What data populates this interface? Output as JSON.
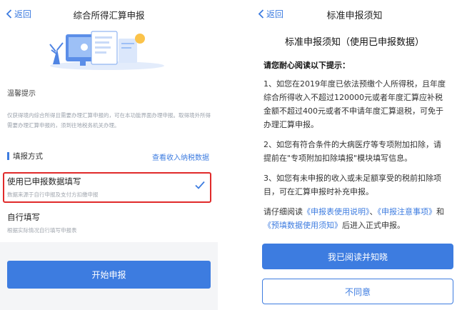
{
  "left": {
    "nav": {
      "back_label": "返回",
      "title": "综合所得汇算申报"
    },
    "notice": {
      "title": "温馨提示",
      "body": "仅获得境内综合所得且需要办理汇算申报的，可在本功能界面办理申报。取得境外所得需要办理汇算申报的，须到往地税务机关办理。"
    },
    "method": {
      "label": "填报方式",
      "link": "查看收入纳税数据",
      "options": [
        {
          "title": "使用已申报数据填写",
          "subtitle": "数据来源于自行申报及支付方扣缴申报",
          "selected": true
        },
        {
          "title": "自行填写",
          "subtitle": "根据实际情况自行填写申报表",
          "selected": false
        }
      ]
    },
    "start_button": "开始申报"
  },
  "right": {
    "nav": {
      "back_label": "返回",
      "title": "标准申报须知"
    },
    "doc_title": "标准申报须知（使用已申报数据）",
    "hint": "请您耐心阅读以下提示：",
    "paragraphs": [
      "1、如您在2019年度已依法预缴个人所得税，且年度综合所得收入不超过120000元或者年度汇算应补税金额不超过400元或者不申请年度汇算退税，可免于办理汇算申报。",
      "2、如您有符合条件的大病医疗等专项附加扣除，请提前在\"专项附加扣除填报\"模块填写信息。",
      "3、如您有未申报的收入或未足额享受的税前扣除项目，可在汇算申报时补充申报。"
    ],
    "final": {
      "prefix": "请仔细阅读",
      "link1": "《申报表使用说明》",
      "sep1": "、",
      "link2": "《申报注意事项》",
      "sep2": "和",
      "link3": "《预填数据使用须知》",
      "suffix": "后进入正式申报。"
    },
    "accept_button": "我已阅读并知晓",
    "reject_button": "不同意"
  },
  "colors": {
    "accent": "#3d7ce0",
    "highlight": "#e02a2a"
  }
}
